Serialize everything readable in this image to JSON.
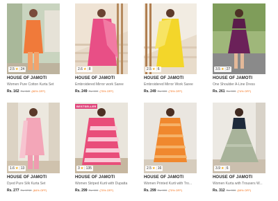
{
  "products": [
    {
      "brand": "HOUSE OF JAMOTI",
      "title": "Women Pure Cotton Kurta Set",
      "price": "Rs. 162",
      "mrp": "Rs. 849",
      "discount": "(80% OFF)",
      "rating": "2.5",
      "reviews": "24",
      "tag": ""
    },
    {
      "brand": "HOUSE OF JAMOTI",
      "title": "Embroidered Mirror work Saree",
      "price": "Rs. 249",
      "mrp": "Rs. 999",
      "discount": "(75% OFF)",
      "rating": "2.6",
      "reviews": "8",
      "tag": ""
    },
    {
      "brand": "HOUSE OF JAMOTI",
      "title": "Embroidered Mirror Work Saree",
      "price": "Rs. 249",
      "mrp": "Rs. 999",
      "discount": "(75% OFF)",
      "rating": "2.5",
      "reviews": "6",
      "tag": ""
    },
    {
      "brand": "HOUSE OF JAMOTI",
      "title": "One Shoulder A-Line Dress",
      "price": "Rs. 261",
      "mrp": "Rs. 999",
      "discount": "(74% OFF)",
      "rating": "3.5",
      "reviews": "27",
      "tag": ""
    },
    {
      "brand": "HOUSE OF JAMOTI",
      "title": "Dyed Pure Silk Kurta Set",
      "price": "Rs. 277",
      "mrp": "Rs. 1749",
      "discount": "(84% OFF)",
      "rating": "1.6",
      "reviews": "13",
      "tag": ""
    },
    {
      "brand": "HOUSE OF JAMOTI",
      "title": "Women Striped Kurti with Dupatta",
      "price": "Rs. 299",
      "mrp": "Rs. 999",
      "discount": "(70% OFF)",
      "rating": "3",
      "reviews": "135",
      "tag": "BESTSELLER"
    },
    {
      "brand": "HOUSE OF JAMOTI",
      "title": "Women Printed Kurti with Tro...",
      "price": "Rs. 299",
      "mrp": "Rs. 999",
      "discount": "(70% OFF)",
      "rating": "2.5",
      "reviews": "16",
      "tag": ""
    },
    {
      "brand": "HOUSE OF JAMOTI",
      "title": "Women Kurta with Trousers W...",
      "price": "Rs. 312",
      "mrp": "Rs. 999",
      "discount": "(69% OFF)",
      "rating": "3.9",
      "reviews": "6",
      "tag": ""
    }
  ],
  "colors": {
    "accent": "#f26a10",
    "star": "#f0a400",
    "tag": "#e0457b"
  }
}
